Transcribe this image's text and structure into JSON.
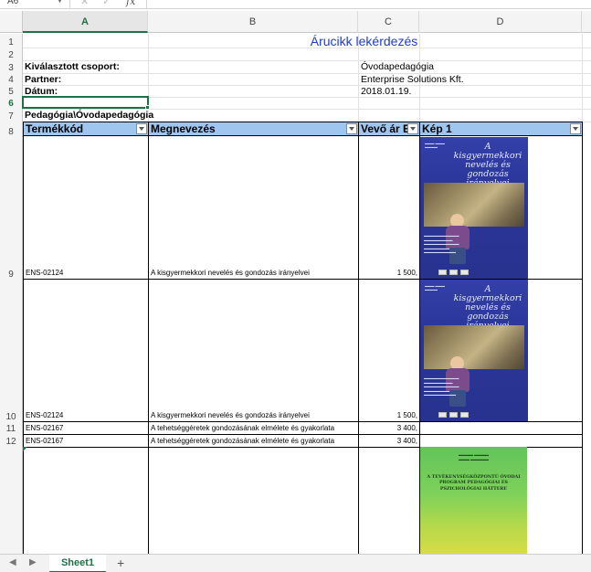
{
  "formula_bar": {
    "name_box": "A6",
    "fx_label": "fx"
  },
  "columns": [
    "A",
    "B",
    "C",
    "D"
  ],
  "rows": [
    "1",
    "2",
    "3",
    "4",
    "5",
    "6",
    "7",
    "8",
    "9",
    "10",
    "11",
    "12"
  ],
  "title": "Árucikk lekérdezés",
  "info": {
    "group_label": "Kiválasztott csoport:",
    "group_value": "Óvodapedagógia",
    "partner_label": "Partner:",
    "partner_value": "Enterprise Solutions Kft.",
    "date_label": "Dátum:",
    "date_value": "2018.01.19."
  },
  "category_path": "Pedagógia\\Óvodapedagógia",
  "table": {
    "headers": [
      "Termékkód",
      "Megnevezés",
      "Vevő ár E",
      "Kép 1"
    ],
    "rows": [
      {
        "code": "ENS-02124",
        "name": "A kisgyermekkori nevelés és gondozás irányelvei",
        "price": "1 500,"
      },
      {
        "code": "ENS-02124",
        "name": "A kisgyermekkori nevelés és gondozás irányelvei",
        "price": "1 500,"
      },
      {
        "code": "ENS-02167",
        "name": "A tehetséggéretek gondozásának elmélete és gyakorlata",
        "price": "3 400,"
      },
      {
        "code": "ENS-02167",
        "name": "A tehetséggéretek gondozásának elmélete és gyakorlata",
        "price": "3 400,"
      }
    ]
  },
  "covers": {
    "blue_title": "A kisgyermekkori nevelés és gondozás irányelvei",
    "green_title": "A TEVÉKENYSÉGKÖZPONTÚ ÓVODAI PROGRAM PEDAGÓGIAI ÉS PSZICHOLÓGIAI HÁTTERE"
  },
  "sheet_tabs": {
    "active": "Sheet1",
    "add": "+"
  },
  "colors": {
    "accent": "#1e7145",
    "title": "#1f3ad6",
    "table_header": "#9fc6ef"
  }
}
